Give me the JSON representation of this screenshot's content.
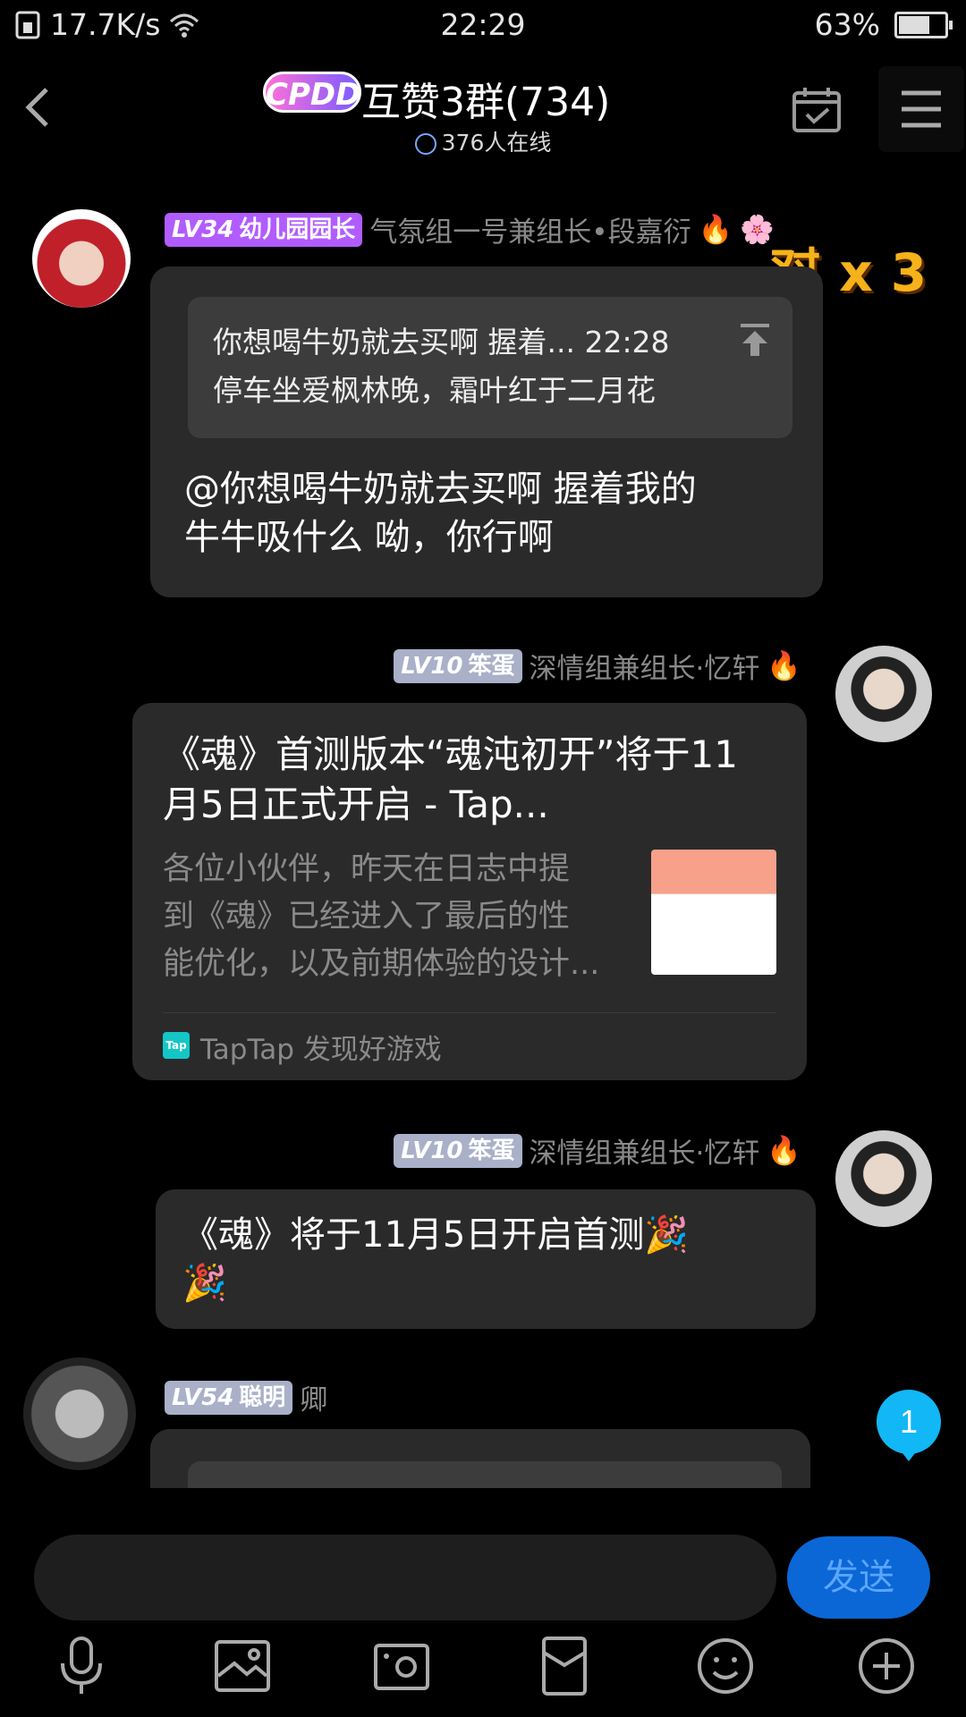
{
  "status_bar": {
    "speed": "17.7K/s",
    "time": "22:29",
    "battery": "63%",
    "battery_level": 0.63
  },
  "header": {
    "logo_text": "CPDD",
    "title": "互赞3群(734)",
    "online": "376人在线"
  },
  "messages": [
    {
      "level_prefix": "LV34",
      "level_title": "幼儿园园长",
      "level_color": "#b15cff",
      "sender": "气氛组一号兼组长•段嘉衍",
      "quote_line1": "你想喝牛奶就去买啊  握着... 22:28",
      "quote_line2": "停车坐爱枫林晚，霜叶红于二月花",
      "text_line1": "@你想喝牛奶就去买啊  握着我的",
      "text_line2": "牛牛吸什么 呦，你行啊",
      "sticker": "怼 x 3"
    },
    {
      "level_prefix": "LV10",
      "level_title": "笨蛋",
      "level_color": "#a9b0c8",
      "sender": "深情组兼组长·忆轩",
      "card_title_line1": "《魂》首测版本“魂沌初开”将于11",
      "card_title_line2": "月5日正式开启 - Tap...",
      "card_desc_line1": "各位小伙伴，昨天在日志中提",
      "card_desc_line2": "到《魂》已经进入了最后的性",
      "card_desc_line3": "能优化，以及前期体验的设计...",
      "card_source_icon": "Tap",
      "card_source": "TapTap 发现好游戏"
    },
    {
      "level_prefix": "LV10",
      "level_title": "笨蛋",
      "level_color": "#a9b0c8",
      "sender": "深情组兼组长·忆轩",
      "text_line1": "《魂》将于11月5日开启首测🎉",
      "text_line2": "🎉"
    },
    {
      "level_prefix": "LV54",
      "level_title": "聪明",
      "level_color": "#a9b0c8",
      "sender": "卿"
    }
  ],
  "unread_count": "1",
  "input": {
    "placeholder": "",
    "send_label": "发送"
  },
  "toolbar": [
    "microphone-icon",
    "image-icon",
    "camera-icon",
    "red-packet-icon",
    "emoji-icon",
    "plus-icon"
  ]
}
